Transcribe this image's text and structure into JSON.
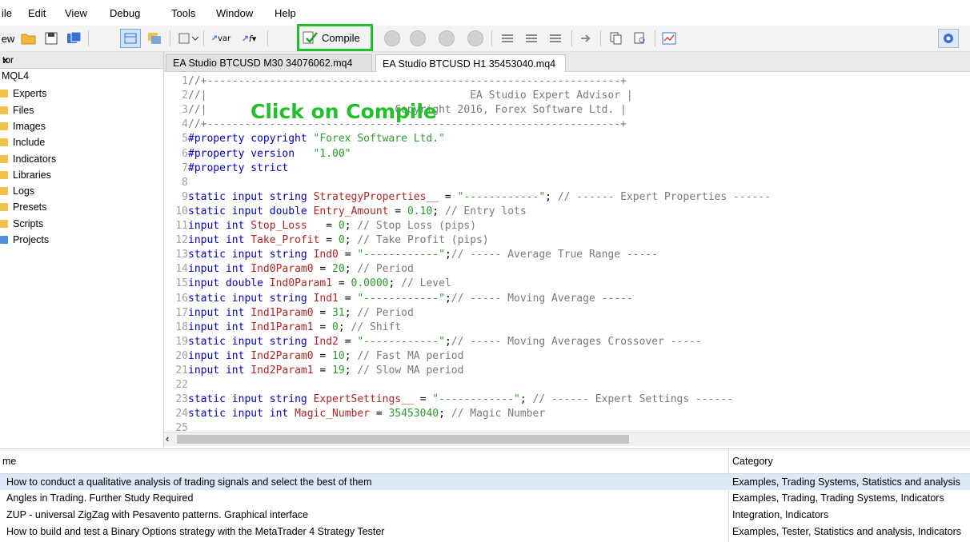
{
  "menu": [
    "ile",
    "Edit",
    "View",
    "Debug",
    "Tools",
    "Window",
    "Help"
  ],
  "toolbar": {
    "new_label": "ew",
    "compile_label": "Compile",
    "var_label": "var",
    "f_label": "f"
  },
  "annotation": "Click on Compile",
  "navigator": {
    "title": "tor",
    "close": "×",
    "root": "MQL4",
    "folders": [
      "Experts",
      "Files",
      "Images",
      "Include",
      "Indicators",
      "Libraries",
      "Logs",
      "Presets",
      "Scripts",
      "Projects"
    ]
  },
  "tabs": [
    "EA Studio BTCUSD M30 34076062.mq4",
    "EA Studio BTCUSD H1 35453040.mq4"
  ],
  "code": [
    {
      "n": "1",
      "t": "//+------------------------------------------------------------------+"
    },
    {
      "n": "2",
      "t": "//|                                          EA Studio Expert Advisor |"
    },
    {
      "n": "3",
      "t": "//|                              Copyright 2016, Forex Software Ltd. |"
    },
    {
      "n": "4",
      "t": "//+------------------------------------------------------------------+"
    },
    {
      "n": "5",
      "t": "#property copyright \"Forex Software Ltd.\""
    },
    {
      "n": "6",
      "t": "#property version   \"1.00\""
    },
    {
      "n": "7",
      "t": "#property strict"
    },
    {
      "n": "8",
      "t": ""
    },
    {
      "n": "9",
      "t": "static input string StrategyProperties__ = \"------------\"; // ------ Expert Properties ------"
    },
    {
      "n": "10",
      "t": "static input double Entry_Amount = 0.10; // Entry lots"
    },
    {
      "n": "11",
      "t": "input int Stop_Loss   = 0; // Stop Loss (pips)"
    },
    {
      "n": "12",
      "t": "input int Take_Profit = 0; // Take Profit (pips)"
    },
    {
      "n": "13",
      "t": "static input string Ind0 = \"------------\";// ----- Average True Range -----"
    },
    {
      "n": "14",
      "t": "input int Ind0Param0 = 20; // Period"
    },
    {
      "n": "15",
      "t": "input double Ind0Param1 = 0.0000; // Level"
    },
    {
      "n": "16",
      "t": "static input string Ind1 = \"------------\";// ----- Moving Average -----"
    },
    {
      "n": "17",
      "t": "input int Ind1Param0 = 31; // Period"
    },
    {
      "n": "18",
      "t": "input int Ind1Param1 = 0; // Shift"
    },
    {
      "n": "19",
      "t": "static input string Ind2 = \"------------\";// ----- Moving Averages Crossover -----"
    },
    {
      "n": "20",
      "t": "input int Ind2Param0 = 10; // Fast MA period"
    },
    {
      "n": "21",
      "t": "input int Ind2Param1 = 19; // Slow MA period"
    },
    {
      "n": "22",
      "t": ""
    },
    {
      "n": "23",
      "t": "static input string ExpertSettings__ = \"------------\"; // ------ Expert Settings ------"
    },
    {
      "n": "24",
      "t": "static input int Magic_Number = 35453040; // Magic Number"
    },
    {
      "n": "25",
      "t": ""
    }
  ],
  "bottom": {
    "col_name": "me",
    "col_category": "Category",
    "rows": [
      {
        "name": "How to conduct a qualitative analysis of trading signals and select the best of them",
        "category": "Examples, Trading Systems, Statistics and analysis"
      },
      {
        "name": "Angles in Trading. Further Study Required",
        "category": "Examples, Trading, Trading Systems, Indicators"
      },
      {
        "name": "ZUP - universal ZigZag with Pesavento patterns. Graphical interface",
        "category": "Integration, Indicators"
      },
      {
        "name": "How to build and test a Binary Options strategy with the MetaTrader 4 Strategy Tester",
        "category": "Examples, Tester, Statistics and analysis, Indicators"
      }
    ]
  }
}
